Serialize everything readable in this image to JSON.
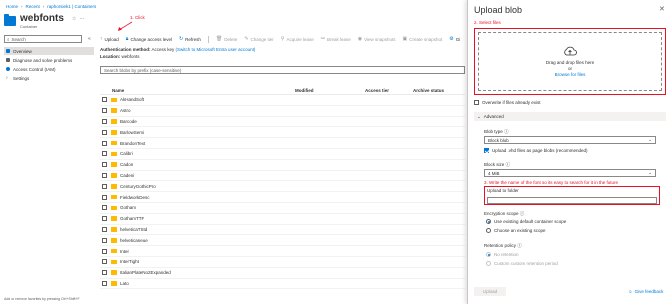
{
  "breadcrumb": [
    "Home",
    "Recent",
    "raphorsiek1 | Containers"
  ],
  "header": {
    "title": "webfonts",
    "subtitle": "Container"
  },
  "leftnav": {
    "search_placeholder": "Search",
    "items": [
      {
        "label": "Overview",
        "color": "#0078d4"
      },
      {
        "label": "Diagnose and solve problems",
        "color": "#605e5c"
      },
      {
        "label": "Access Control (IAM)",
        "color": "#0078d4"
      },
      {
        "label": "Settings",
        "color": "#605e5c"
      }
    ]
  },
  "annotations": {
    "step1": "1. Click",
    "step2": "2. Select files",
    "step3": "3. Write the name of the font so its easy to search for it in the future"
  },
  "toolbar": {
    "upload": "Upload",
    "change_access": "Change access level",
    "refresh": "Refresh",
    "delete": "Delete",
    "change_tier": "Change tier",
    "acquire_lease": "Acquire lease",
    "break_lease": "Break lease",
    "view_snapshots": "View snapshots",
    "create_snapshot": "Create snapshot",
    "more": "Gi"
  },
  "auth": {
    "label": "Authentication method:",
    "value": "Access key",
    "link": "(Switch to Microsoft Entra user account)",
    "location_label": "Location:",
    "location_value": "webfonts"
  },
  "prefix_placeholder": "Search blobs by prefix (case-sensitive)",
  "table": {
    "columns": [
      "Name",
      "Modified",
      "Access tier",
      "Archive status"
    ],
    "rows": [
      "AkHandSoft",
      "Astro",
      "Barcode",
      "BarlowSemi",
      "BrandonText",
      "Calibri",
      "Cadon",
      "Cadeni",
      "CenturyGothicPro",
      "FieldworkDesc",
      "Gotham",
      "GothamTTF",
      "helveticaTStd",
      "helveticaneue",
      "Inter",
      "InterTight",
      "ItalianPlateNo2Expanded",
      "Lato"
    ]
  },
  "footer_note": "Add or remove favorites by pressing Ctrl+Shift+F",
  "panel": {
    "title": "Upload blob",
    "drop_text_1": "Drag and drop files here",
    "drop_text_2": "or",
    "browse": "Browse for files",
    "overwrite": "Overwrite if files already exist",
    "advanced": "Advanced",
    "blob_type_label": "Blob type",
    "blob_type_value": "Block blob",
    "vhd_label": "Upload .vhd files as page blobs (recommended)",
    "block_size_label": "Block size",
    "block_size_value": "4 MiB",
    "folder_label": "Upload to folder",
    "folder_value": "",
    "encryption_label": "Encryption scope",
    "enc_opt1": "Use existing default container scope",
    "enc_opt2": "Choose an existing scope",
    "retention_label": "Retention policy",
    "ret_opt1": "No retention",
    "ret_opt2": "Custom custom retention period",
    "upload_button": "Upload",
    "feedback": "Give feedback"
  }
}
